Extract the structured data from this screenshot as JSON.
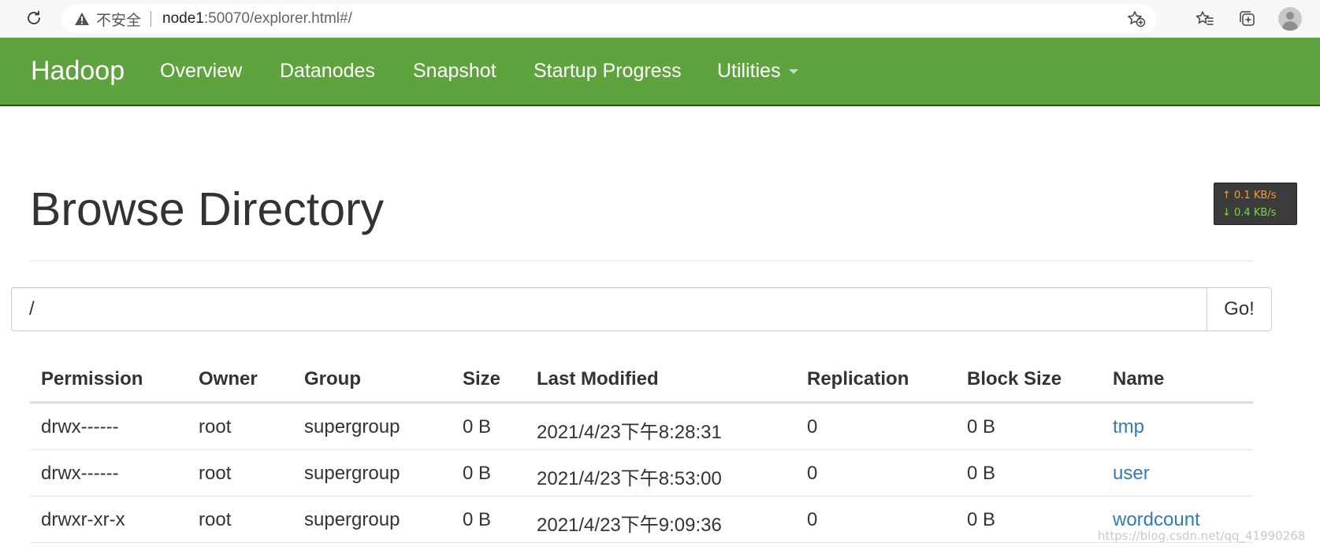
{
  "browser": {
    "security_label": "不安全",
    "url_host": "node1",
    "url_rest": ":50070/explorer.html#/"
  },
  "navbar": {
    "brand": "Hadoop",
    "items": [
      {
        "label": "Overview"
      },
      {
        "label": "Datanodes"
      },
      {
        "label": "Snapshot"
      },
      {
        "label": "Startup Progress"
      },
      {
        "label": "Utilities"
      }
    ]
  },
  "page": {
    "title": "Browse Directory"
  },
  "speed_widget": {
    "up": "↑ 0.1 KB/s",
    "down": "↓ 0.4 KB/s"
  },
  "path_bar": {
    "value": "/",
    "go_label": "Go!"
  },
  "table": {
    "headers": [
      "Permission",
      "Owner",
      "Group",
      "Size",
      "Last Modified",
      "Replication",
      "Block Size",
      "Name"
    ],
    "rows": [
      [
        "drwx------",
        "root",
        "supergroup",
        "0 B",
        "2021/4/23下午8:28:31",
        "0",
        "0 B",
        "tmp"
      ],
      [
        "drwx------",
        "root",
        "supergroup",
        "0 B",
        "2021/4/23下午8:53:00",
        "0",
        "0 B",
        "user"
      ],
      [
        "drwxr-xr-x",
        "root",
        "supergroup",
        "0 B",
        "2021/4/23下午9:09:36",
        "0",
        "0 B",
        "wordcount"
      ]
    ]
  },
  "watermark": "https://blog.csdn.net/qq_41990268",
  "colors": {
    "navbar": "#5fa33e",
    "link": "#337ab7"
  }
}
